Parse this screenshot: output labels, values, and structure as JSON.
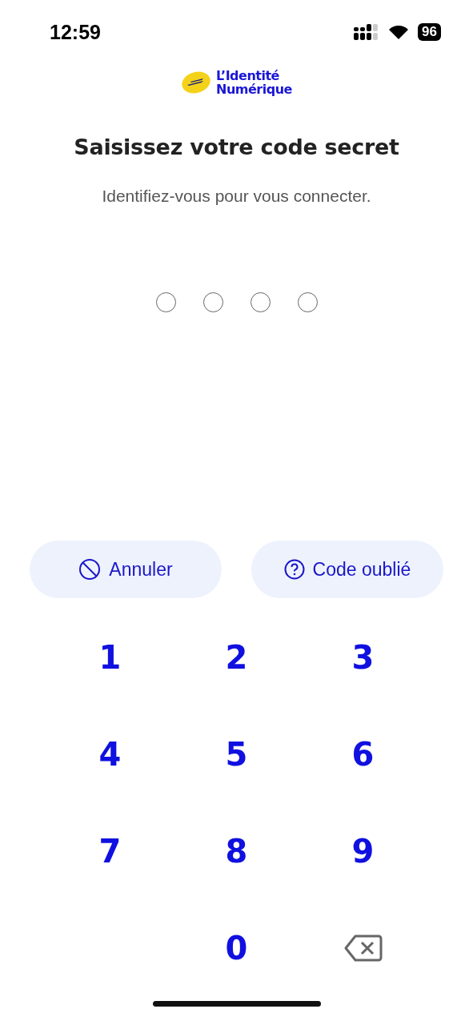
{
  "status_bar": {
    "time": "12:59",
    "battery": "96"
  },
  "logo": {
    "line1": "L’Identité",
    "line2": "Numérique"
  },
  "title": "Saisissez votre code secret",
  "subtitle": "Identifiez-vous pour vous connecter.",
  "pin_dots": [
    {
      "filled": false
    },
    {
      "filled": false
    },
    {
      "filled": false
    },
    {
      "filled": false
    }
  ],
  "actions": [
    {
      "kind": "cancel",
      "label": "Annuler"
    },
    {
      "kind": "help",
      "label": "Code oublié"
    }
  ],
  "keypad": [
    {
      "kind": "digit",
      "label": "1"
    },
    {
      "kind": "digit",
      "label": "2"
    },
    {
      "kind": "digit",
      "label": "3"
    },
    {
      "kind": "digit",
      "label": "4"
    },
    {
      "kind": "digit",
      "label": "5"
    },
    {
      "kind": "digit",
      "label": "6"
    },
    {
      "kind": "digit",
      "label": "7"
    },
    {
      "kind": "digit",
      "label": "8"
    },
    {
      "kind": "digit",
      "label": "9"
    },
    {
      "kind": "blank"
    },
    {
      "kind": "digit",
      "label": "0"
    },
    {
      "kind": "backspace"
    }
  ]
}
